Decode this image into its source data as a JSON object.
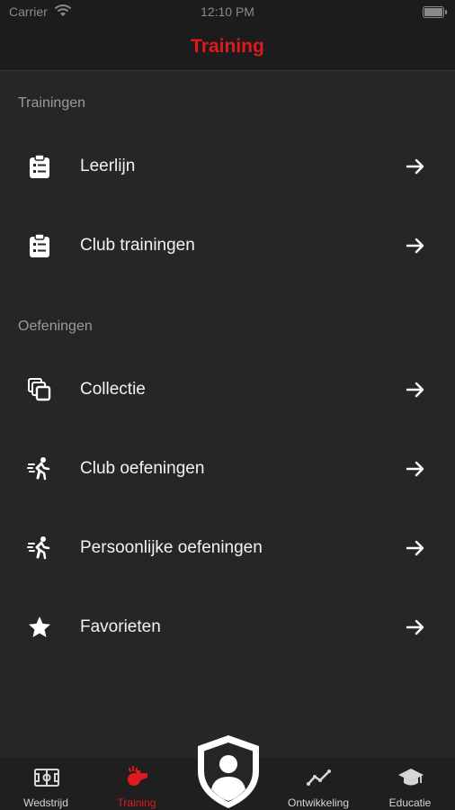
{
  "status_bar": {
    "carrier": "Carrier",
    "time": "12:10 PM"
  },
  "header": {
    "title": "Training"
  },
  "sections": [
    {
      "title": "Trainingen",
      "items": [
        {
          "label": "Leerlijn",
          "icon": "clipboard-list-icon"
        },
        {
          "label": "Club trainingen",
          "icon": "clipboard-list-icon"
        }
      ]
    },
    {
      "title": "Oefeningen",
      "items": [
        {
          "label": "Collectie",
          "icon": "stacked-squares-icon"
        },
        {
          "label": "Club oefeningen",
          "icon": "running-person-icon"
        },
        {
          "label": "Persoonlijke oefeningen",
          "icon": "running-person-icon"
        },
        {
          "label": "Favorieten",
          "icon": "star-icon"
        }
      ]
    }
  ],
  "tab_bar": {
    "tabs": [
      {
        "label": "Wedstrijd",
        "icon": "soccer-field-icon"
      },
      {
        "label": "Training",
        "icon": "whistle-icon",
        "active": true
      },
      {
        "label": "",
        "icon": "profile-shield-icon"
      },
      {
        "label": "Ontwikkeling",
        "icon": "trend-line-icon"
      },
      {
        "label": "Educatie",
        "icon": "graduation-cap-icon"
      }
    ]
  },
  "colors": {
    "accent": "#e0191e",
    "background": "#262626",
    "bar": "#1c1c1c"
  }
}
